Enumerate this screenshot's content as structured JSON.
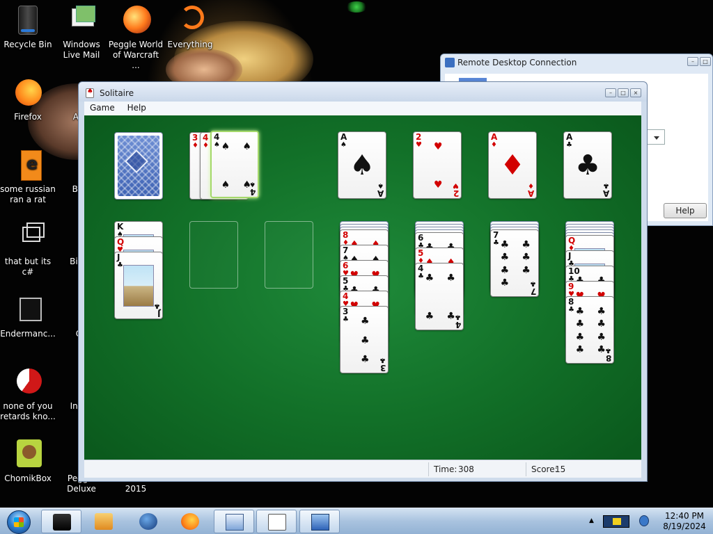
{
  "desktop": {
    "icons": [
      {
        "label": "Recycle Bin"
      },
      {
        "label": "Windows Live Mail"
      },
      {
        "label": "Peggle World of Warcraft ..."
      },
      {
        "label": "Everything"
      },
      {
        "label": "Firefox"
      },
      {
        "label": "Astr De"
      },
      {
        "label": "some russian ran a rat"
      },
      {
        "label": "Beje De"
      },
      {
        "label": "that but its c#"
      },
      {
        "label": "Big M De"
      },
      {
        "label": "Endermanc..."
      },
      {
        "label": "Ch De"
      },
      {
        "label": "none of you retards kno..."
      },
      {
        "label": "Insan De"
      },
      {
        "label": "ChomikBox"
      },
      {
        "label": "Peggle Deluxe"
      },
      {
        "label": "2015"
      }
    ]
  },
  "rdp_window": {
    "title": "Remote Desktop Connection",
    "help_button": "Help"
  },
  "solitaire": {
    "title": "Solitaire",
    "menu": [
      "Game",
      "Help"
    ],
    "status": {
      "time_label": "Time:",
      "time_value": "308",
      "score_label": "Score:",
      "score_value": "15"
    },
    "stock": {
      "cards_face_down": true
    },
    "waste": [
      {
        "rank": "3",
        "suit": "♦",
        "color": "red"
      },
      {
        "rank": "4",
        "suit": "♦",
        "color": "red"
      },
      {
        "rank": "4",
        "suit": "♠",
        "color": "black"
      }
    ],
    "foundations": [
      {
        "rank": "A",
        "suit": "♠",
        "color": "black"
      },
      {
        "rank": "2",
        "suit": "♥",
        "color": "red"
      },
      {
        "rank": "A",
        "suit": "♦",
        "color": "red"
      },
      {
        "rank": "A",
        "suit": "♣",
        "color": "black"
      }
    ],
    "tableau": [
      {
        "hidden": 0,
        "cards": [
          {
            "rank": "K",
            "suit": "♠",
            "color": "black"
          },
          {
            "rank": "Q",
            "suit": "♥",
            "color": "red"
          },
          {
            "rank": "J",
            "suit": "♣",
            "color": "black"
          }
        ]
      },
      {
        "hidden": 0,
        "cards": []
      },
      {
        "hidden": 0,
        "cards": []
      },
      {
        "hidden": 3,
        "cards": [
          {
            "rank": "8",
            "suit": "♦",
            "color": "red"
          },
          {
            "rank": "7",
            "suit": "♠",
            "color": "black"
          },
          {
            "rank": "6",
            "suit": "♥",
            "color": "red"
          },
          {
            "rank": "5",
            "suit": "♣",
            "color": "black"
          },
          {
            "rank": "4",
            "suit": "♥",
            "color": "red"
          },
          {
            "rank": "3",
            "suit": "♣",
            "color": "black"
          }
        ]
      },
      {
        "hidden": 4,
        "cards": [
          {
            "rank": "6",
            "suit": "♣",
            "color": "black"
          },
          {
            "rank": "5",
            "suit": "♦",
            "color": "red"
          },
          {
            "rank": "4",
            "suit": "♣",
            "color": "black"
          }
        ]
      },
      {
        "hidden": 3,
        "cards": [
          {
            "rank": "7",
            "suit": "♣",
            "color": "black"
          }
        ]
      },
      {
        "hidden": 5,
        "cards": [
          {
            "rank": "Q",
            "suit": "♦",
            "color": "red"
          },
          {
            "rank": "J",
            "suit": "♣",
            "color": "black"
          },
          {
            "rank": "10",
            "suit": "♣",
            "color": "black"
          },
          {
            "rank": "9",
            "suit": "♥",
            "color": "red"
          },
          {
            "rank": "8",
            "suit": "♣",
            "color": "black"
          }
        ]
      }
    ]
  },
  "taskbar": {
    "clock_time": "12:40 PM",
    "clock_date": "8/19/2024",
    "apps": [
      {
        "icon": "black-window-icon"
      },
      {
        "icon": "media-center-icon"
      },
      {
        "icon": "globe-icon"
      },
      {
        "icon": "firefox-icon"
      },
      {
        "icon": "keyboard-screen-icon"
      },
      {
        "icon": "solitaire-icon"
      },
      {
        "icon": "remote-desktop-icon"
      }
    ]
  }
}
